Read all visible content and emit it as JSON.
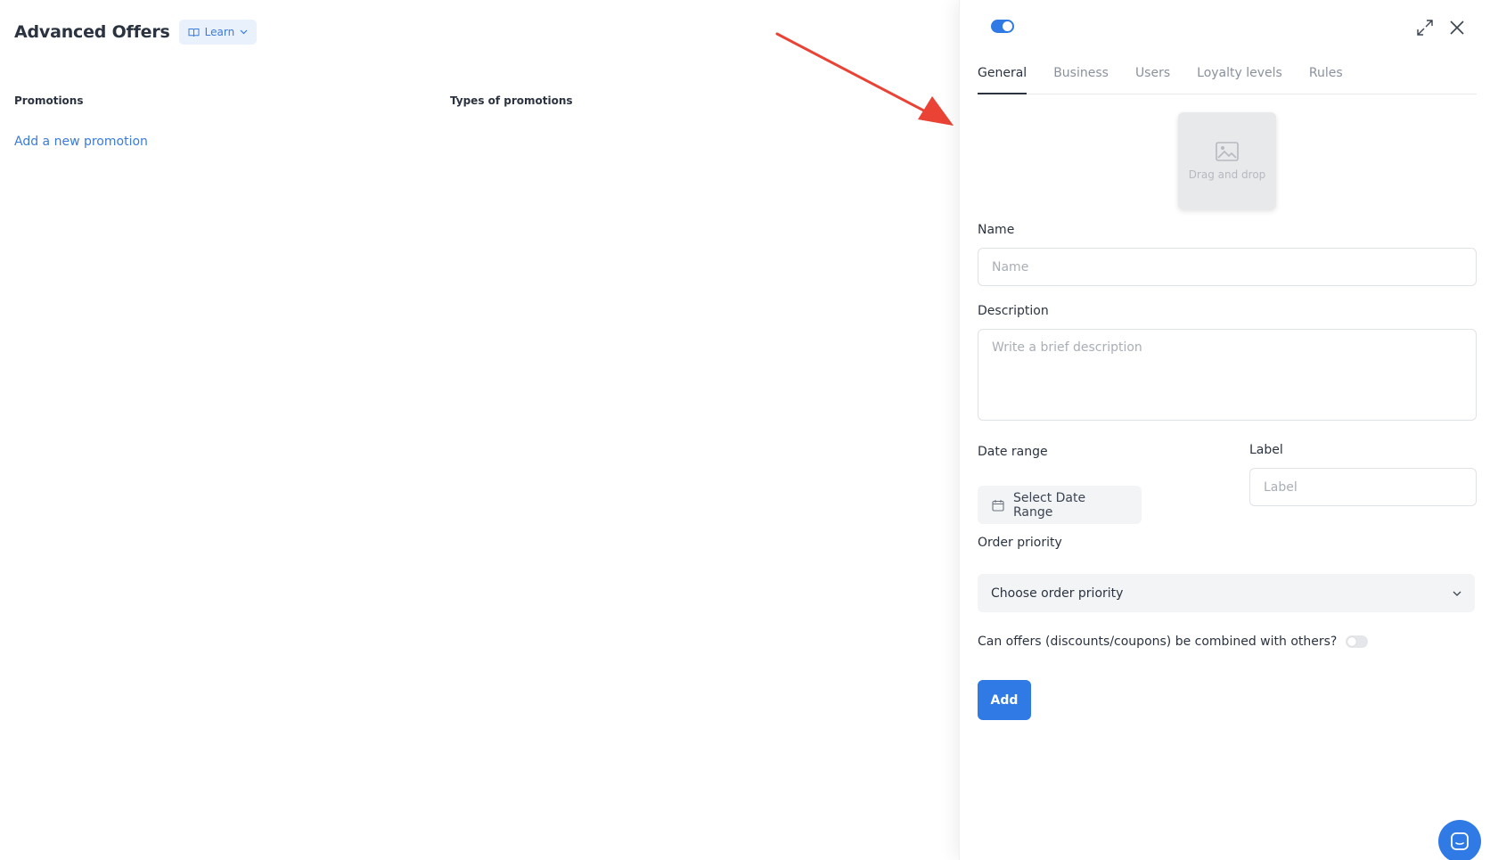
{
  "page": {
    "title": "Advanced Offers",
    "learn_label": "Learn",
    "columns": {
      "promotions": "Promotions",
      "types": "Types of promotions"
    },
    "add_promotion": "Add a new promotion"
  },
  "panel": {
    "tabs": [
      {
        "label": "General",
        "active": true
      },
      {
        "label": "Business",
        "active": false
      },
      {
        "label": "Users",
        "active": false
      },
      {
        "label": "Loyalty levels",
        "active": false
      },
      {
        "label": "Rules",
        "active": false
      }
    ],
    "dropzone_text": "Drag and drop",
    "name": {
      "label": "Name",
      "placeholder": "Name"
    },
    "description": {
      "label": "Description",
      "placeholder": "Write a brief description"
    },
    "date_range": {
      "label": "Date range",
      "button": "Select Date Range"
    },
    "label_field": {
      "label": "Label",
      "placeholder": "Label"
    },
    "order_priority": {
      "label": "Order priority",
      "value": "Choose order priority"
    },
    "combine_question": "Can offers (discounts/coupons) be combined with others?",
    "add_button": "Add"
  },
  "colors": {
    "accent": "#2f7ae5",
    "link": "#3b7bd9",
    "annotation_arrow": "#ea4335"
  },
  "icons": [
    "book-icon",
    "chevron-down-icon",
    "expand-icon",
    "close-icon",
    "image-icon",
    "calendar-icon",
    "chat-icon"
  ]
}
